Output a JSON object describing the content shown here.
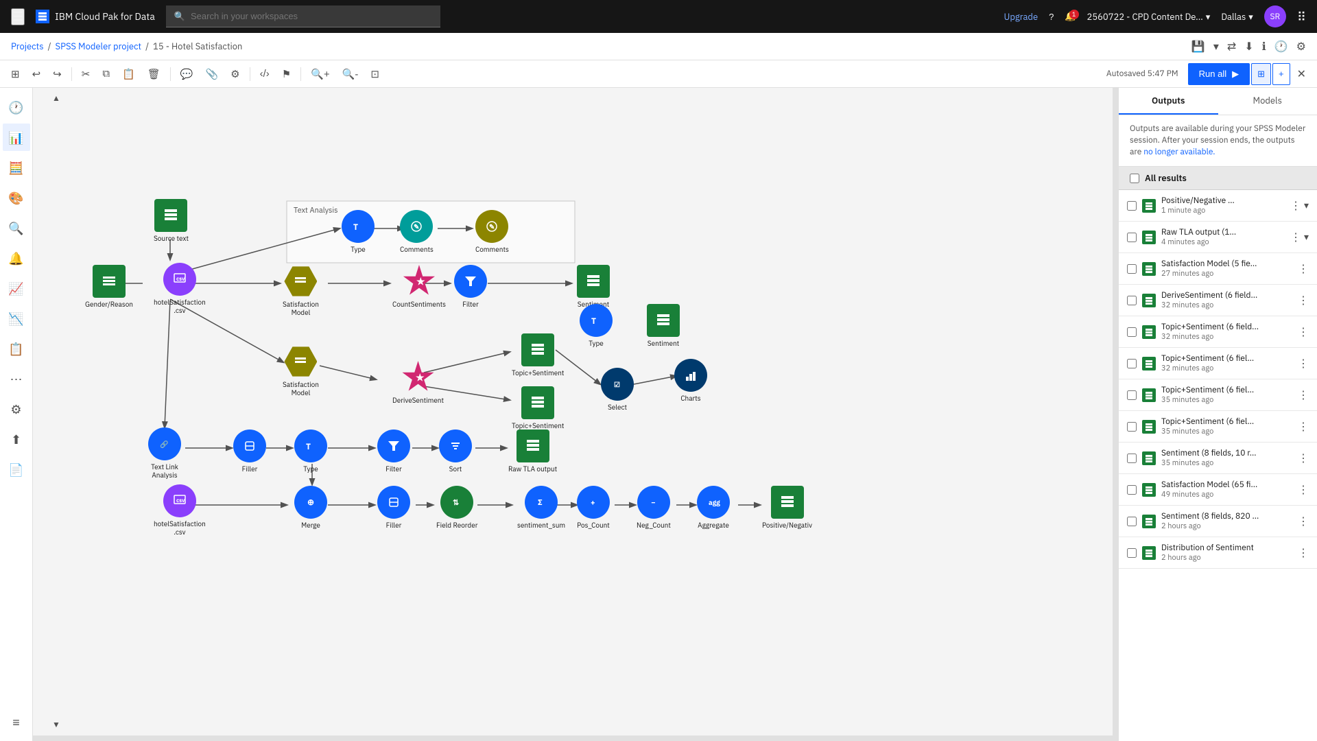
{
  "app": {
    "title": "IBM Cloud Pak for Data",
    "logo_text": "IBM",
    "logo_box_color": "#0f62fe"
  },
  "navbar": {
    "search_placeholder": "Search in your workspaces",
    "upgrade_label": "Upgrade",
    "notifications_count": "1",
    "workspace_label": "2560722 - CPD Content De...",
    "region_label": "Dallas",
    "user_initials": "SR"
  },
  "breadcrumb": {
    "projects": "Projects",
    "modeler": "SPSS Modeler project",
    "current": "15 - Hotel Satisfaction"
  },
  "toolbar": {
    "autosave": "Autosaved 5:47 PM",
    "run_all": "Run all"
  },
  "panels": {
    "outputs_label": "Outputs",
    "models_label": "Models",
    "description": "Outputs are available during your SPSS Modeler session. After your session ends, the outputs are no longer available.",
    "all_results_label": "All results"
  },
  "results": [
    {
      "name": "Positive/Negative ...",
      "time": "1 minute ago",
      "expandable": true
    },
    {
      "name": "Raw TLA output (1...",
      "time": "4 minutes ago",
      "expandable": true
    },
    {
      "name": "Satisfaction Model (5 fie...",
      "time": "27 minutes ago",
      "expandable": false
    },
    {
      "name": "DeriveSentiment (6 field...",
      "time": "32 minutes ago",
      "expandable": false
    },
    {
      "name": "Topic+Sentiment (6 field...",
      "time": "32 minutes ago",
      "expandable": false
    },
    {
      "name": "Topic+Sentiment (6 fiel...",
      "time": "32 minutes ago",
      "expandable": false
    },
    {
      "name": "Topic+Sentiment (6 fiel...",
      "time": "35 minutes ago",
      "expandable": false
    },
    {
      "name": "Topic+Sentiment (6 fiel...",
      "time": "35 minutes ago",
      "expandable": false
    },
    {
      "name": "Sentiment (8 fields, 10 r...",
      "time": "35 minutes ago",
      "expandable": false
    },
    {
      "name": "Satisfaction Model (65 fi...",
      "time": "49 minutes ago",
      "expandable": false
    },
    {
      "name": "Sentiment (8 fields, 820 ...",
      "time": "2 hours ago",
      "expandable": false
    },
    {
      "name": "Distribution of Sentiment",
      "time": "2 hours ago",
      "expandable": false
    }
  ],
  "flow_nodes": {
    "source_text": {
      "label": "Source text",
      "type": "green_grid"
    },
    "hotel_satisfaction_csv": {
      "label": "hotelSatisfaction.csv",
      "type": "purple_circle"
    },
    "gender_reason": {
      "label": "Gender/Reason",
      "type": "green_doc"
    },
    "satisfaction_model_1": {
      "label": "Satisfaction Model",
      "type": "olive_hex"
    },
    "count_sentiments": {
      "label": "CountSentiments",
      "type": "pink_star"
    },
    "filter_1": {
      "label": "Filter",
      "type": "blue_filter"
    },
    "sentiment_1": {
      "label": "Sentiment",
      "type": "green_grid"
    },
    "type_1": {
      "label": "Type",
      "type": "blue_type"
    },
    "sentiment_2": {
      "label": "Sentiment",
      "type": "green_grid"
    },
    "satisfaction_model_2": {
      "label": "Satisfaction Model",
      "type": "olive_hex2"
    },
    "derive_sentiment": {
      "label": "DeriveSentiment",
      "type": "pink_star2"
    },
    "topic_sentiment_1": {
      "label": "Topic+Sentiment",
      "type": "green_grid2"
    },
    "topic_sentiment_2": {
      "label": "Topic+Sentiment",
      "type": "green_grid3"
    },
    "select": {
      "label": "Select",
      "type": "blue_select"
    },
    "charts": {
      "label": "Charts",
      "type": "blue_charts"
    },
    "text_link_analysis": {
      "label": "Text Link Analysis",
      "type": "blue_tla"
    },
    "filler": {
      "label": "Filler",
      "type": "blue_filler"
    },
    "type_2": {
      "label": "Type",
      "type": "blue_type2"
    },
    "filter_2": {
      "label": "Filter",
      "type": "blue_filter2"
    },
    "sort": {
      "label": "Sort",
      "type": "blue_sort"
    },
    "raw_tla_output": {
      "label": "Raw TLA output",
      "type": "green_grid4"
    },
    "hotel_satisfaction_csv2": {
      "label": "hotelSatisfaction.csv",
      "type": "purple_circle2"
    },
    "merge": {
      "label": "Merge",
      "type": "blue_merge"
    },
    "filter_3": {
      "label": "Filler",
      "type": "blue_filter3"
    },
    "field_reorder": {
      "label": "Field Reorder",
      "type": "green_reorder"
    },
    "sentiment_sum": {
      "label": "sentiment_sum",
      "type": "blue_sentsum"
    },
    "pos_count": {
      "label": "Pos_Count",
      "type": "blue_poscount"
    },
    "neg_count": {
      "label": "Neg_Count",
      "type": "blue_negcount"
    },
    "aggregate": {
      "label": "Aggregate",
      "type": "blue_aggregate"
    },
    "positive_negative": {
      "label": "Positive/Negativ",
      "type": "green_grid5"
    }
  },
  "colors": {
    "green": "#198038",
    "blue": "#0f62fe",
    "purple": "#8a3ffc",
    "pink": "#d12771",
    "teal": "#009d9a",
    "olive": "#8c8500",
    "dark_green": "#1a7a3e",
    "accent": "#0f62fe"
  }
}
